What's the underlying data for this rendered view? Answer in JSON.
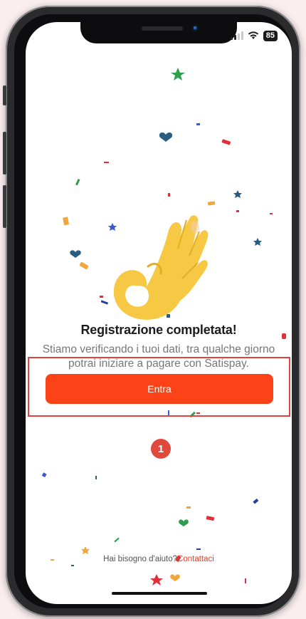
{
  "status_bar": {
    "battery": "85"
  },
  "main": {
    "title": "Registrazione completata!",
    "subtitle": "Stiamo verificando i tuoi dati, tra qualche giorno potrai iniziare a pagare con Satispay.",
    "enter_button": "Entra"
  },
  "annotation": {
    "step_number": "1"
  },
  "footer": {
    "help_text": "Hai bisogno d'aiuto?",
    "contact_link": "Contattaci"
  },
  "colors": {
    "accent": "#fb4317",
    "highlight_border": "#e3433f",
    "hand": "#f7c843"
  },
  "icons": {
    "hero": "ok-hand-icon",
    "wifi": "wifi-icon",
    "signal": "signal-icon",
    "battery": "battery-icon"
  }
}
